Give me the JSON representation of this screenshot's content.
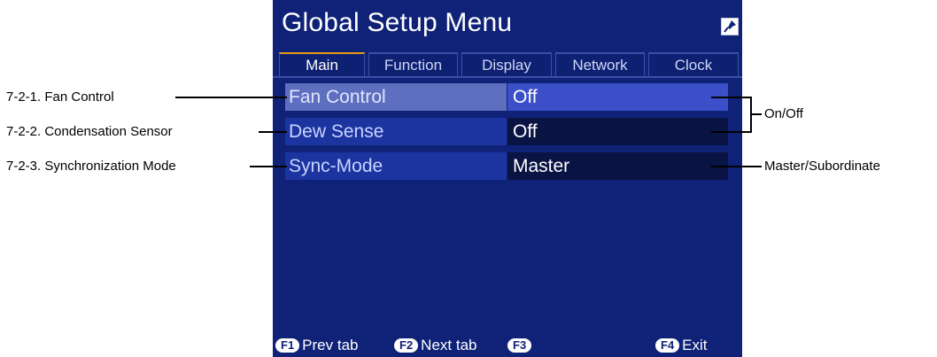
{
  "screen": {
    "title": "Global Setup Menu",
    "title_icon": "pin-icon",
    "tabs": [
      {
        "label": "Main",
        "active": true
      },
      {
        "label": "Function",
        "active": false
      },
      {
        "label": "Display",
        "active": false
      },
      {
        "label": "Network",
        "active": false
      },
      {
        "label": "Clock",
        "active": false
      }
    ],
    "rows": [
      {
        "label": "Fan Control",
        "value": "Off",
        "selected": true
      },
      {
        "label": "Dew Sense",
        "value": "Off",
        "selected": false
      },
      {
        "label": "Sync-Mode",
        "value": "Master",
        "selected": false
      }
    ],
    "function_keys": [
      {
        "key": "F1",
        "label": "Prev tab"
      },
      {
        "key": "F2",
        "label": "Next tab"
      },
      {
        "key": "F3",
        "label": ""
      },
      {
        "key": "F4",
        "label": "Exit"
      }
    ]
  },
  "callouts": {
    "left": [
      "7-2-1. Fan Control",
      "7-2-2. Condensation Sensor",
      "7-2-3. Synchronization Mode"
    ],
    "right": [
      "On/Off",
      "Master/Subordinate"
    ]
  },
  "colors": {
    "screen_bg": "#0f2277",
    "selected_label": "#5f6fc0",
    "selected_value": "#3b4fc8",
    "row_label": "#1c34a0",
    "row_value": "#0a1444",
    "tab_active_accent": "#e69a16"
  }
}
